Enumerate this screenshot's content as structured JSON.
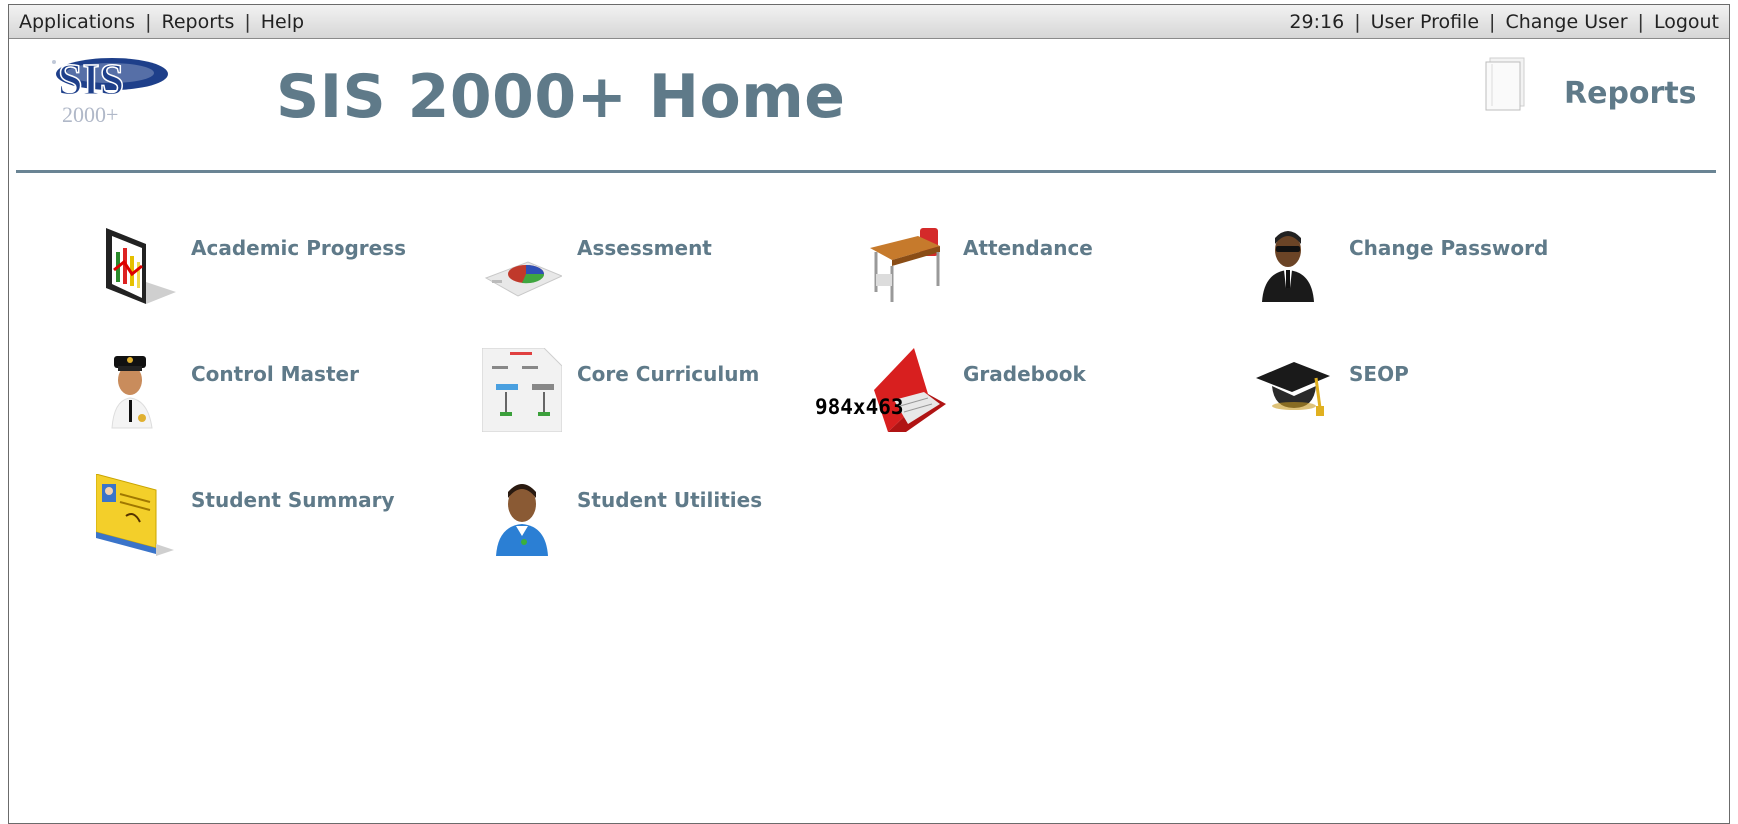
{
  "menu": {
    "left": [
      "Applications",
      "Reports",
      "Help"
    ],
    "timer": "29:16",
    "right": [
      "User Profile",
      "Change User",
      "Logout"
    ]
  },
  "header": {
    "logo_text": "SIS",
    "logo_sub": "2000+",
    "title": "SIS 2000+ Home",
    "reports_label": "Reports"
  },
  "tiles": [
    {
      "label": "Academic Progress",
      "icon": "chart-board-icon"
    },
    {
      "label": "Assessment",
      "icon": "pie-chart-icon"
    },
    {
      "label": "Attendance",
      "icon": "school-desk-icon"
    },
    {
      "label": "Change Password",
      "icon": "agent-person-icon"
    },
    {
      "label": "Control Master",
      "icon": "officer-person-icon"
    },
    {
      "label": "Core Curriculum",
      "icon": "flowchart-icon"
    },
    {
      "label": "Gradebook",
      "icon": "grade-book-icon"
    },
    {
      "label": "SEOP",
      "icon": "graduation-cap-icon"
    },
    {
      "label": "Student Summary",
      "icon": "id-card-icon"
    },
    {
      "label": "Student Utilities",
      "icon": "student-person-icon"
    }
  ],
  "overlay_text": "984x463",
  "colors": {
    "title": "#5f7a89",
    "rule": "#6a8494",
    "menubar_top": "#f2f2f2",
    "menubar_bottom": "#d6d6d6"
  }
}
